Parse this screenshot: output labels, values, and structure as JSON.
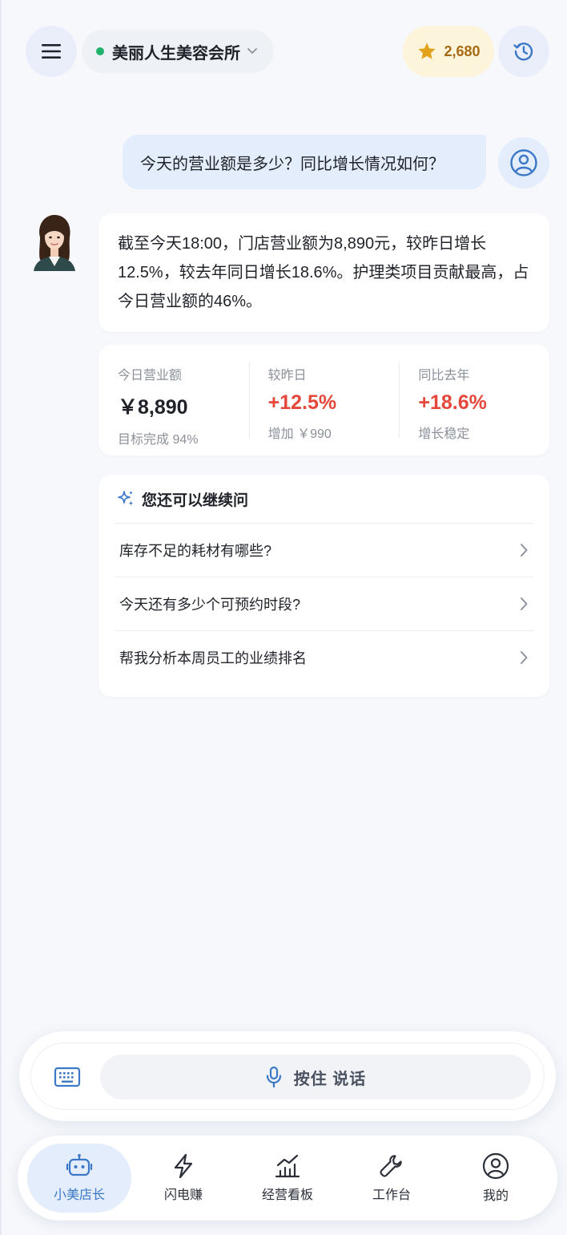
{
  "header": {
    "store_name": "美丽人生美容会所",
    "store_status_color": "#21b36b",
    "points": "2,680",
    "icons": {
      "menu": "menu-icon",
      "star": "star-icon",
      "history": "history-icon",
      "chevron": "chevron-down-icon"
    }
  },
  "chat": {
    "user_question": "今天的营业额是多少？同比增长情况如何？",
    "bot_answer": "截至今天18:00，门店营业额为8,890元，较昨日增长12.5%，较去年同日增长18.6%。护理类项目贡献最高，占今日营业额的46%。"
  },
  "stats": [
    {
      "label": "今日营业额",
      "value": "￥8,890",
      "sub": "目标完成 94%",
      "trend": "neutral"
    },
    {
      "label": "较昨日",
      "value": "+12.5%",
      "sub": "增加 ￥990",
      "trend": "up"
    },
    {
      "label": "同比去年",
      "value": "+18.6%",
      "sub": "增长稳定",
      "trend": "up"
    }
  ],
  "suggestions": {
    "title": "您还可以继续问",
    "items": [
      "库存不足的耗材有哪些?",
      "今天还有多少个可预约时段?",
      "帮我分析本周员工的业绩排名"
    ]
  },
  "input": {
    "voice_label": "按住 说话"
  },
  "nav": {
    "items": [
      {
        "label": "小美店长",
        "icon": "robot-icon",
        "active": true
      },
      {
        "label": "闪电赚",
        "icon": "lightning-icon",
        "active": false
      },
      {
        "label": "经营看板",
        "icon": "chart-icon",
        "active": false
      },
      {
        "label": "工作台",
        "icon": "wrench-icon",
        "active": false
      },
      {
        "label": "我的",
        "icon": "user-icon",
        "active": false
      }
    ]
  },
  "colors": {
    "accent": "#3c78c8",
    "up": "#e5473a",
    "points_text": "#a76a12"
  }
}
